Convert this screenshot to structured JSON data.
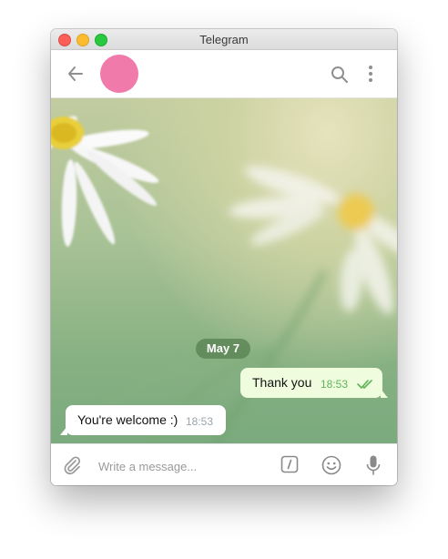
{
  "window": {
    "title": "Telegram"
  },
  "chat": {
    "date_separator": "May 7",
    "messages": [
      {
        "direction": "out",
        "text": "Thank you",
        "time": "18:53",
        "status": "read"
      },
      {
        "direction": "in",
        "text": "You're welcome :)",
        "time": "18:53"
      }
    ]
  },
  "composer": {
    "placeholder": "Write a message..."
  },
  "colors": {
    "avatar": "#f07aaa",
    "outgoing_bubble": "#effdde",
    "outgoing_time": "#5fb457",
    "date_pill": "#547e4e"
  },
  "icons": {
    "back": "arrow-left-icon",
    "search": "search-icon",
    "more": "more-vertical-icon",
    "attach": "paperclip-icon",
    "commands": "slash-command-icon",
    "emoji": "smiley-icon",
    "voice": "microphone-icon"
  }
}
